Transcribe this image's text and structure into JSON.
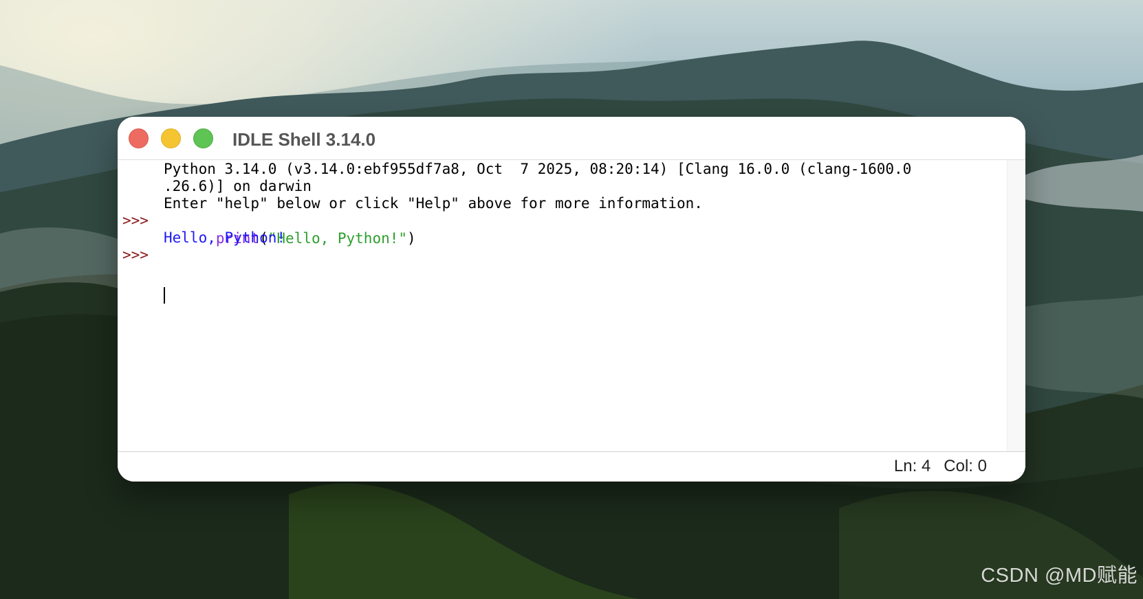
{
  "desktop": {
    "watermark": "CSDN @MD赋能"
  },
  "window": {
    "title": "IDLE Shell 3.14.0",
    "controls": {
      "close": "close",
      "minimize": "minimize",
      "maximize": "maximize"
    },
    "shell": {
      "intro_line_1": "Python 3.14.0 (v3.14.0:ebf955df7a8, Oct  7 2025, 08:20:14) [Clang 16.0.0 (clang-1600.0",
      "intro_line_2": ".26.6)] on darwin",
      "intro_line_3": "Enter \"help\" below or click \"Help\" above for more information.",
      "prompt": ">>>",
      "command_keyword": "print",
      "command_open": "(",
      "command_string": "\"Hello, Python!\"",
      "command_close": ")",
      "output": "Hello, Python!"
    },
    "status": {
      "line": "Ln: 4",
      "column": "Col: 0"
    }
  }
}
